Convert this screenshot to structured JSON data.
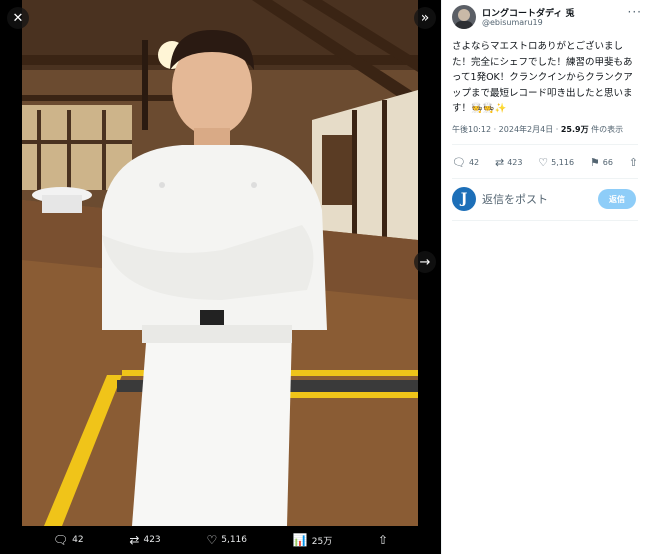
{
  "viewer": {
    "close_icon": "✕",
    "collapse_icon": "»",
    "next_icon": "→",
    "image_alt": "photo",
    "actions": [
      {
        "icon": "reply-icon",
        "glyph": "🗨",
        "count": "42"
      },
      {
        "icon": "retweet-icon",
        "glyph": "⇄",
        "count": "423"
      },
      {
        "icon": "like-icon",
        "glyph": "♡",
        "count": "5,116"
      },
      {
        "icon": "views-icon",
        "glyph": "📊",
        "count": "25万"
      },
      {
        "icon": "share-icon",
        "glyph": "⇧",
        "count": ""
      }
    ]
  },
  "tweet": {
    "author_name": "ロングコートダディ 兎",
    "handle": "@ebisumaru19",
    "more": "···",
    "text": "さよならマエストロありがとございました！完全にシェフでした！練習の甲斐もあって1発OK！クランクインからクランクアップまで最短レコード叩き出したと思います！🧑‍🍳🧑‍🍳✨",
    "time": "午後10:12 · 2024年2月4日 · ",
    "views": "25.9万",
    "views_suffix": " 件の表示",
    "actions": {
      "reply": "42",
      "retweet": "423",
      "like": "5,116",
      "bookmark": "66"
    }
  },
  "reply": {
    "avatar_letter": "J",
    "placeholder": "返信をポスト",
    "button": "返信"
  },
  "colors": {
    "accent": "#1d9bf0",
    "reply_button": "#8ecdf8",
    "text_secondary": "#536471"
  }
}
